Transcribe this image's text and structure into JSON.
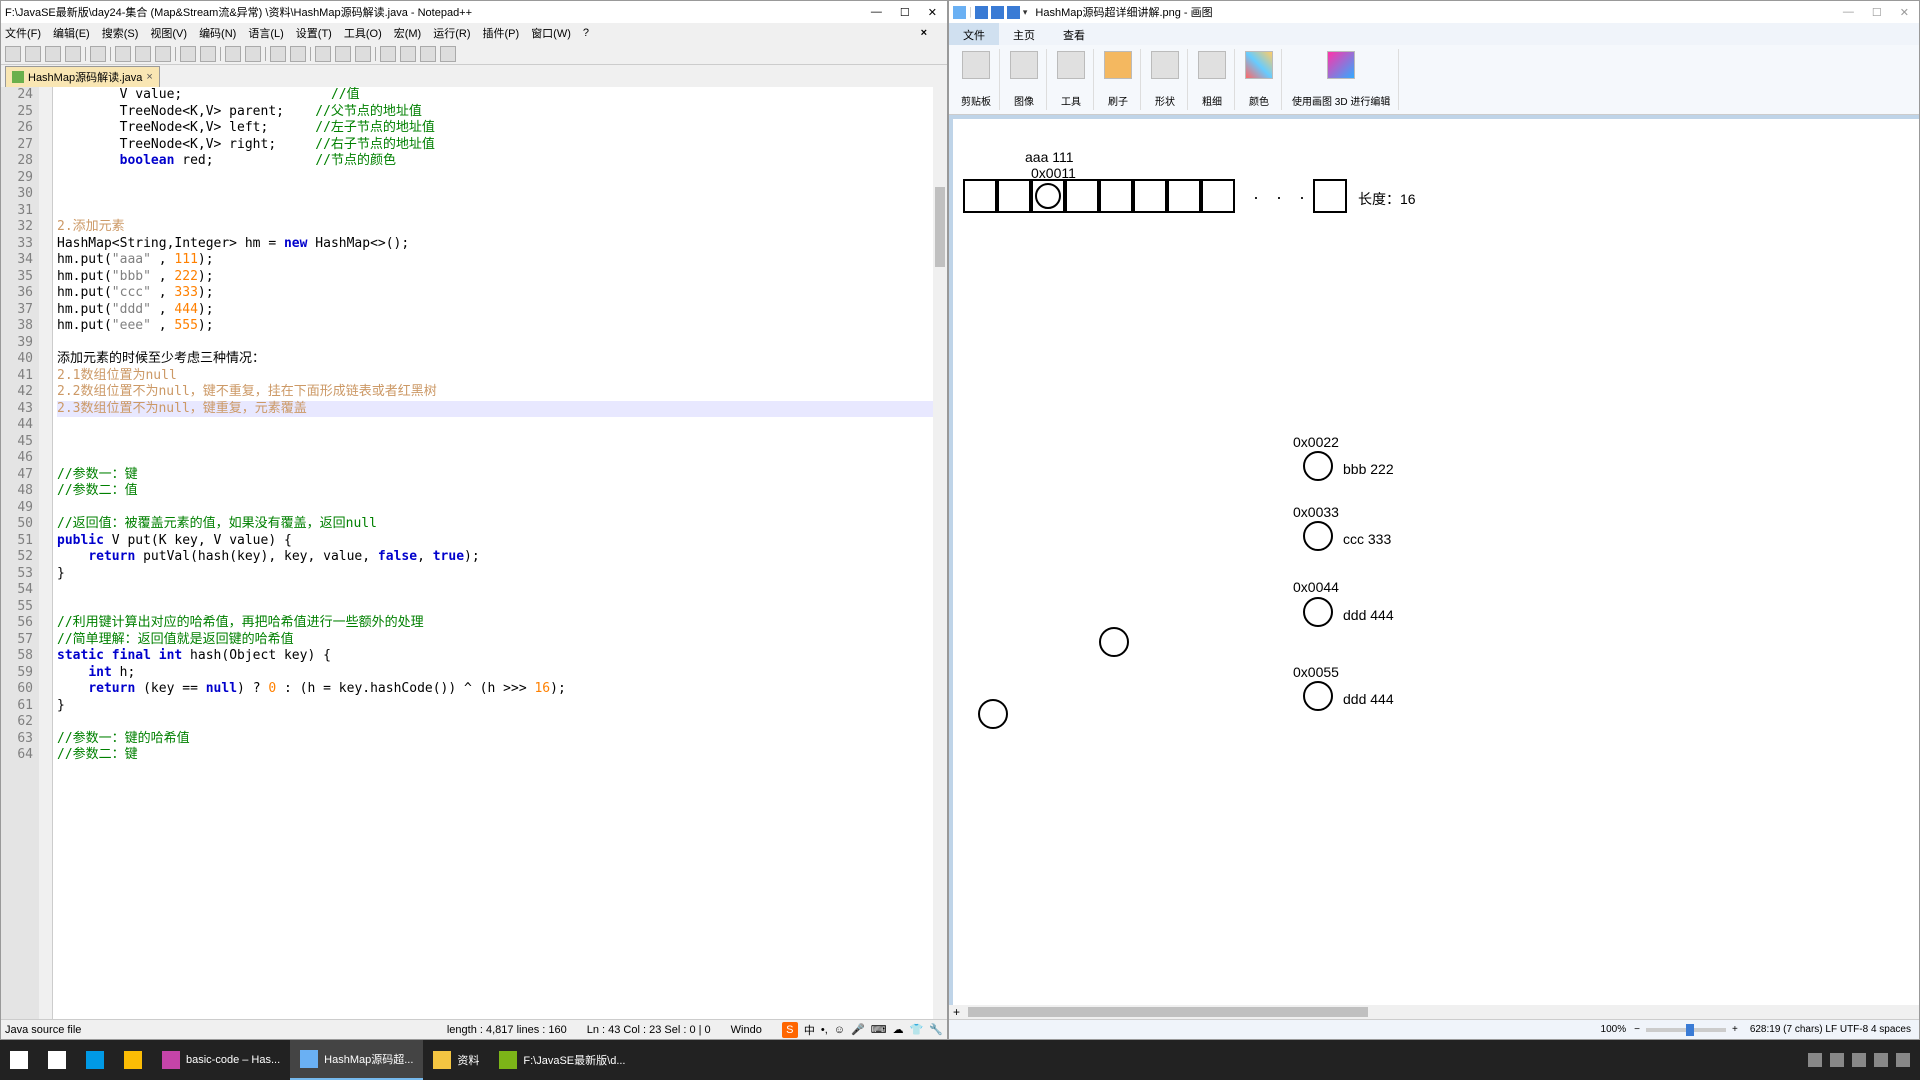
{
  "npp": {
    "title": "F:\\JavaSE最新版\\day24-集合 (Map&Stream流&异常) \\资料\\HashMap源码解读.java - Notepad++",
    "menus": [
      "文件(F)",
      "编辑(E)",
      "搜索(S)",
      "视图(V)",
      "编码(N)",
      "语言(L)",
      "设置(T)",
      "工具(O)",
      "宏(M)",
      "运行(R)",
      "插件(P)",
      "窗口(W)",
      "?"
    ],
    "tab": "HashMap源码解读.java",
    "lines": {
      "24": {
        "segs": [
          {
            "t": "        V value;",
            "c": ""
          },
          {
            "t": "                   //值",
            "c": "cm"
          }
        ]
      },
      "25": {
        "segs": [
          {
            "t": "        TreeNode<K,V> parent;    ",
            "c": ""
          },
          {
            "t": "//父节点的地址值",
            "c": "cm"
          }
        ]
      },
      "26": {
        "segs": [
          {
            "t": "        TreeNode<K,V> left;      ",
            "c": ""
          },
          {
            "t": "//左子节点的地址值",
            "c": "cm"
          }
        ]
      },
      "27": {
        "segs": [
          {
            "t": "        TreeNode<K,V> right;     ",
            "c": ""
          },
          {
            "t": "//右子节点的地址值",
            "c": "cm"
          }
        ]
      },
      "28": {
        "segs": [
          {
            "t": "        ",
            "c": ""
          },
          {
            "t": "boolean",
            "c": "kw"
          },
          {
            "t": " red;             ",
            "c": ""
          },
          {
            "t": "//节点的颜色",
            "c": "cm"
          }
        ]
      },
      "29": {
        "segs": [
          {
            "t": " ",
            "c": ""
          }
        ]
      },
      "30": {
        "segs": [
          {
            "t": " ",
            "c": ""
          }
        ]
      },
      "31": {
        "segs": [
          {
            "t": " ",
            "c": ""
          }
        ]
      },
      "32": {
        "segs": [
          {
            "t": "2.添加元素",
            "c": "or"
          }
        ]
      },
      "33": {
        "segs": [
          {
            "t": "HashMap<String,Integer> hm = ",
            "c": ""
          },
          {
            "t": "new",
            "c": "kw"
          },
          {
            "t": " HashMap<>();",
            "c": ""
          }
        ]
      },
      "34": {
        "segs": [
          {
            "t": "hm.put(",
            "c": ""
          },
          {
            "t": "\"aaa\"",
            "c": "str"
          },
          {
            "t": " , ",
            "c": ""
          },
          {
            "t": "111",
            "c": "num"
          },
          {
            "t": ");",
            "c": ""
          }
        ]
      },
      "35": {
        "segs": [
          {
            "t": "hm.put(",
            "c": ""
          },
          {
            "t": "\"bbb\"",
            "c": "str"
          },
          {
            "t": " , ",
            "c": ""
          },
          {
            "t": "222",
            "c": "num"
          },
          {
            "t": ");",
            "c": ""
          }
        ]
      },
      "36": {
        "segs": [
          {
            "t": "hm.put(",
            "c": ""
          },
          {
            "t": "\"ccc\"",
            "c": "str"
          },
          {
            "t": " , ",
            "c": ""
          },
          {
            "t": "333",
            "c": "num"
          },
          {
            "t": ");",
            "c": ""
          }
        ]
      },
      "37": {
        "segs": [
          {
            "t": "hm.put(",
            "c": ""
          },
          {
            "t": "\"ddd\"",
            "c": "str"
          },
          {
            "t": " , ",
            "c": ""
          },
          {
            "t": "444",
            "c": "num"
          },
          {
            "t": ");",
            "c": ""
          }
        ]
      },
      "38": {
        "segs": [
          {
            "t": "hm.put(",
            "c": ""
          },
          {
            "t": "\"eee\"",
            "c": "str"
          },
          {
            "t": " , ",
            "c": ""
          },
          {
            "t": "555",
            "c": "num"
          },
          {
            "t": ");",
            "c": ""
          }
        ]
      },
      "39": {
        "segs": [
          {
            "t": " ",
            "c": ""
          }
        ]
      },
      "40": {
        "segs": [
          {
            "t": "添加元素的时候至少考虑三种情况：",
            "c": ""
          }
        ]
      },
      "41": {
        "segs": [
          {
            "t": "2.1数组位置为null",
            "c": "or"
          }
        ]
      },
      "42": {
        "segs": [
          {
            "t": "2.2数组位置不为null，键不重复，挂在下面形成链表或者红黑树",
            "c": "or"
          }
        ]
      },
      "43": {
        "hl": true,
        "segs": [
          {
            "t": "2.3数组位置不为null，键重复，元素覆盖",
            "c": "or"
          }
        ]
      },
      "44": {
        "segs": [
          {
            "t": " ",
            "c": ""
          }
        ]
      },
      "45": {
        "segs": [
          {
            "t": " ",
            "c": ""
          }
        ]
      },
      "46": {
        "segs": [
          {
            "t": " ",
            "c": ""
          }
        ]
      },
      "47": {
        "segs": [
          {
            "t": "//参数一：键",
            "c": "cm"
          }
        ]
      },
      "48": {
        "segs": [
          {
            "t": "//参数二：值",
            "c": "cm"
          }
        ]
      },
      "49": {
        "segs": [
          {
            "t": " ",
            "c": ""
          }
        ]
      },
      "50": {
        "segs": [
          {
            "t": "//返回值：被覆盖元素的值，如果没有覆盖，返回null",
            "c": "cm"
          }
        ]
      },
      "51": {
        "segs": [
          {
            "t": "public",
            "c": "kw"
          },
          {
            "t": " V put(K key, V value) {",
            "c": ""
          }
        ]
      },
      "52": {
        "segs": [
          {
            "t": "    ",
            "c": ""
          },
          {
            "t": "return",
            "c": "kw"
          },
          {
            "t": " putVal(hash(key), key, value, ",
            "c": ""
          },
          {
            "t": "false",
            "c": "kw"
          },
          {
            "t": ", ",
            "c": ""
          },
          {
            "t": "true",
            "c": "kw"
          },
          {
            "t": ");",
            "c": ""
          }
        ]
      },
      "53": {
        "segs": [
          {
            "t": "}",
            "c": ""
          }
        ]
      },
      "54": {
        "segs": [
          {
            "t": " ",
            "c": ""
          }
        ]
      },
      "55": {
        "segs": [
          {
            "t": " ",
            "c": ""
          }
        ]
      },
      "56": {
        "segs": [
          {
            "t": "//利用键计算出对应的哈希值，再把哈希值进行一些额外的处理",
            "c": "cm"
          }
        ]
      },
      "57": {
        "segs": [
          {
            "t": "//简单理解：返回值就是返回键的哈希值",
            "c": "cm"
          }
        ]
      },
      "58": {
        "segs": [
          {
            "t": "static final int",
            "c": "kw"
          },
          {
            "t": " hash(Object key) {",
            "c": ""
          }
        ]
      },
      "59": {
        "segs": [
          {
            "t": "    ",
            "c": ""
          },
          {
            "t": "int",
            "c": "kw"
          },
          {
            "t": " h;",
            "c": ""
          }
        ]
      },
      "60": {
        "segs": [
          {
            "t": "    ",
            "c": ""
          },
          {
            "t": "return",
            "c": "kw"
          },
          {
            "t": " (key == ",
            "c": ""
          },
          {
            "t": "null",
            "c": "kw"
          },
          {
            "t": ") ? ",
            "c": ""
          },
          {
            "t": "0",
            "c": "num"
          },
          {
            "t": " : (h = key.hashCode()) ^ (h >>> ",
            "c": ""
          },
          {
            "t": "16",
            "c": "num"
          },
          {
            "t": ");",
            "c": ""
          }
        ]
      },
      "61": {
        "segs": [
          {
            "t": "}",
            "c": ""
          }
        ]
      },
      "62": {
        "segs": [
          {
            "t": " ",
            "c": ""
          }
        ]
      },
      "63": {
        "segs": [
          {
            "t": "//参数一：键的哈希值",
            "c": "cm"
          }
        ]
      },
      "64": {
        "segs": [
          {
            "t": "//参数二：键",
            "c": "cm"
          }
        ]
      }
    },
    "status": {
      "lang": "Java source file",
      "length": "length : 4,817   lines : 160",
      "pos": "Ln : 43   Col : 23   Sel : 0 | 0",
      "os": "Windo"
    }
  },
  "paint": {
    "title": "HashMap源码超详细讲解.png - 画图",
    "tabs": [
      "文件",
      "主页",
      "查看"
    ],
    "ribbon": [
      "剪贴板",
      "图像",
      "工具",
      "刷子",
      "形状",
      "粗细",
      "颜色",
      "使用画图 3D 进行编辑"
    ],
    "canvas": {
      "topLabel1": "aaa   111",
      "topLabel2": "0x0011",
      "lengthLabel": "长度：16",
      "dots": "·  ·  ·",
      "nodes": [
        {
          "addr": "0x0022",
          "label": "bbb 222"
        },
        {
          "addr": "0x0033",
          "label": "ccc 333"
        },
        {
          "addr": "0x0044",
          "label": "ddd 444"
        },
        {
          "addr": "0x0055",
          "label": "ddd 444"
        }
      ]
    },
    "status": {
      "zoom": "100%",
      "info": "628:19 (7 chars) LF UTF-8 4 spaces"
    }
  },
  "taskbar": {
    "items": [
      {
        "label": "",
        "icon": "win"
      },
      {
        "label": "",
        "icon": "search"
      },
      {
        "label": "",
        "icon": "app1"
      },
      {
        "label": "",
        "icon": "chrome"
      },
      {
        "label": "basic-code – Has...",
        "icon": "ij"
      },
      {
        "label": "HashMap源码超...",
        "icon": "paint",
        "active": true
      },
      {
        "label": "资料",
        "icon": "folder"
      },
      {
        "label": "F:\\JavaSE最新版\\d...",
        "icon": "npp"
      }
    ],
    "time": ""
  }
}
